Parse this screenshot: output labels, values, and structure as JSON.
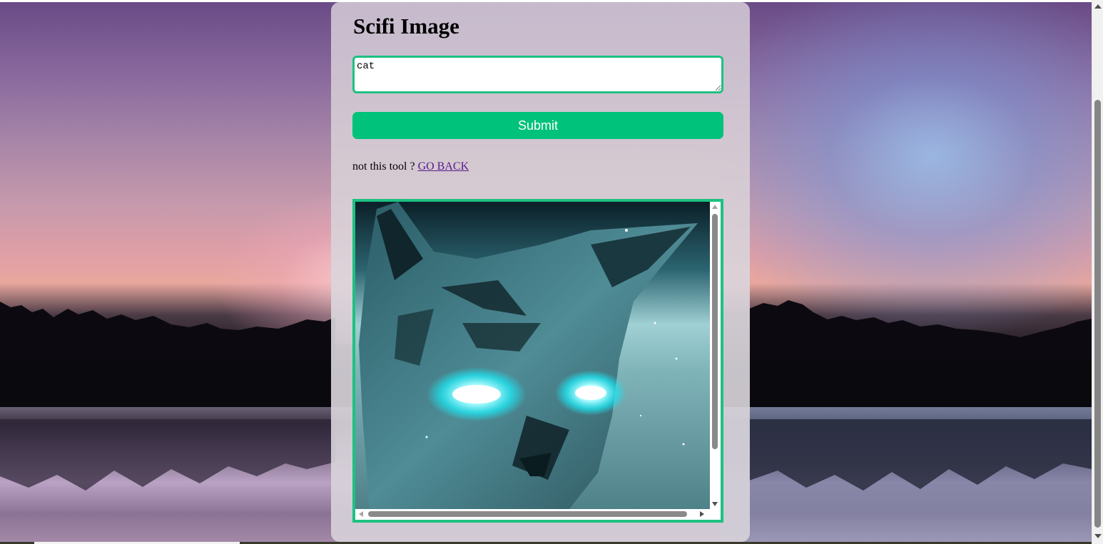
{
  "page": {
    "title": "Scifi Image"
  },
  "form": {
    "prompt_value": "cat",
    "submit_label": "Submit"
  },
  "navigation": {
    "prompt_text": "not this tool ?",
    "back_link": "GO BACK"
  },
  "result": {
    "image_subject": "glowing-eyed sci-fi cat"
  },
  "colors": {
    "accent": "#00c27b",
    "border_accent": "#1ec182",
    "link": "#551a8b",
    "glow": "#37e9f0"
  },
  "icons": {
    "scroll_up": "chevron-up-icon",
    "scroll_down": "chevron-down-icon",
    "scroll_left": "chevron-left-icon",
    "scroll_right": "chevron-right-icon"
  }
}
